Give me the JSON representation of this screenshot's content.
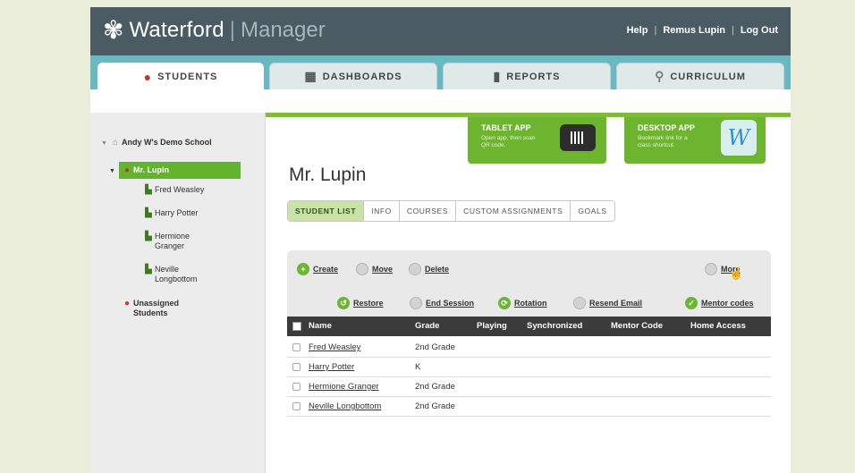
{
  "header": {
    "brand": "Waterford",
    "separator": "|",
    "product": "Manager",
    "links": {
      "help": "Help",
      "user": "Remus Lupin",
      "logout": "Log Out",
      "sep": "|"
    }
  },
  "main_tabs": {
    "students": "STUDENTS",
    "dashboards": "DASHBOARDS",
    "reports": "REPORTS",
    "curriculum": "CURRICULUM"
  },
  "sidebar": {
    "school": "Andy W's Demo School",
    "teacher": "Mr. Lupin",
    "students": [
      "Fred Weasley",
      "Harry Potter",
      "Hermione Granger",
      "Neville Longbottom"
    ],
    "unassigned": "Unassigned Students"
  },
  "apps": {
    "tablet": {
      "title": "TABLET APP",
      "desc": "Open app, then scan QR code."
    },
    "desktop": {
      "title": "DESKTOP APP",
      "desc": "Bookmark link for a class shortcut."
    }
  },
  "page_title": "Mr. Lupin",
  "sub_tabs": [
    "STUDENT LIST",
    "INFO",
    "COURSES",
    "CUSTOM ASSIGNMENTS",
    "GOALS"
  ],
  "actions": {
    "create": "Create",
    "move": "Move",
    "delete": "Delete",
    "more": "More",
    "restore": "Restore",
    "end_session": "End Session",
    "rotation": "Rotation",
    "resend_email": "Resend Email",
    "mentor_codes": "Mentor codes"
  },
  "table": {
    "headers": {
      "name": "Name",
      "grade": "Grade",
      "playing": "Playing",
      "synchronized": "Synchronized",
      "mentor_code": "Mentor Code",
      "home_access": "Home Access"
    },
    "rows": [
      {
        "name": "Fred Weasley",
        "grade": "2nd Grade"
      },
      {
        "name": "Harry Potter",
        "grade": "K"
      },
      {
        "name": "Hermione Granger",
        "grade": "2nd Grade"
      },
      {
        "name": "Neville Longbottom",
        "grade": "2nd Grade"
      }
    ]
  },
  "colors": {
    "header_bg": "#4b5b63",
    "tab_bar_bg": "#69b9c2",
    "accent_green": "#6db52e",
    "table_header_bg": "#3b3b3b"
  }
}
